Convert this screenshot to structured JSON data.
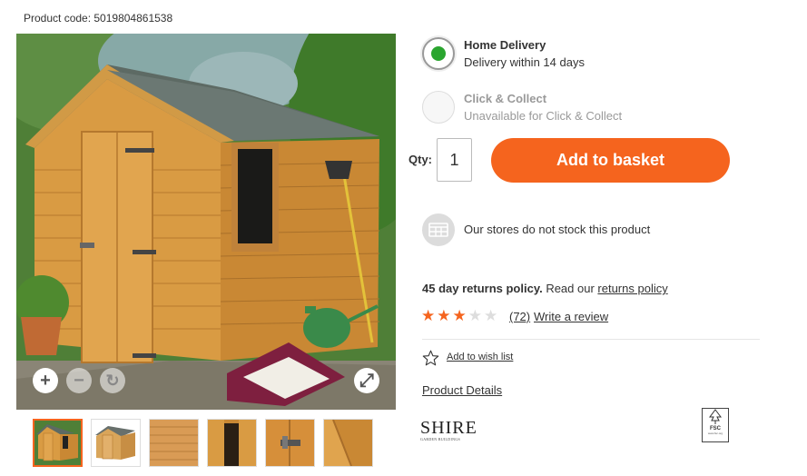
{
  "product": {
    "code_label": "Product code: 5019804861538"
  },
  "image_controls": {
    "zoom_in": "+",
    "zoom_out": "−",
    "reset": "↻",
    "fullscreen": "⤢"
  },
  "delivery": {
    "home": {
      "title": "Home Delivery",
      "subtitle": "Delivery within 14 days",
      "selected": true
    },
    "collect": {
      "title": "Click & Collect",
      "subtitle": "Unavailable for Click & Collect",
      "available": false
    }
  },
  "purchase": {
    "qty_label": "Qty:",
    "qty_value": "1",
    "add_to_basket": "Add to basket"
  },
  "stock": {
    "text": "Our stores do not stock this product"
  },
  "returns": {
    "bold": "45 day returns policy.",
    "prefix": " Read our ",
    "link": "returns policy"
  },
  "reviews": {
    "rating": 3,
    "max": 5,
    "count": "(72)",
    "write_link": "Write a review"
  },
  "wishlist": {
    "label": "Add to wish list"
  },
  "details": {
    "label": "Product Details"
  },
  "brand": {
    "name": "SHIRE",
    "tagline": "GARDEN BUILDINGS"
  },
  "fsc": {
    "label": "FSC",
    "sub": "www.fsc.org"
  },
  "colors": {
    "accent": "#f5641e",
    "selected_radio": "#2aa52f"
  },
  "icons": {
    "store": "store-icon",
    "wish": "star-outline-icon"
  }
}
